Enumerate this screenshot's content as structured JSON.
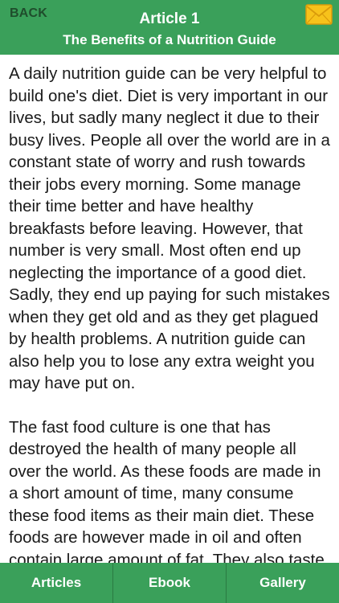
{
  "header": {
    "back_label": "BACK",
    "title": "Article 1",
    "subtitle": "The Benefits of a Nutrition Guide",
    "mail_icon": "envelope-icon"
  },
  "article": {
    "paragraphs": [
      "A daily nutrition guide can be very helpful to build one's diet. Diet is very important in our lives, but sadly many neglect it due to their busy lives. People all over the world are in a constant state of worry and rush towards their jobs every morning. Some manage their time better and have healthy breakfasts before leaving. However, that number is very small. Most often end up neglecting the importance of a good diet. Sadly, they end up paying for such mistakes when they get old and as they get plagued by health problems. A nutrition guide can also help you to lose any extra weight you may have put on.",
      "The fast food culture is one that has destroyed the health of many people all over the world. As these foods are made in a short amount of time, many consume these food items as their main diet. These foods are however made in oil and often contain large amount of fat. They also taste"
    ]
  },
  "tabs": [
    {
      "label": "Articles"
    },
    {
      "label": "Ebook"
    },
    {
      "label": "Gallery"
    }
  ],
  "colors": {
    "bar_green": "#3aa05a",
    "mail_yellow": "#f7c21b"
  }
}
